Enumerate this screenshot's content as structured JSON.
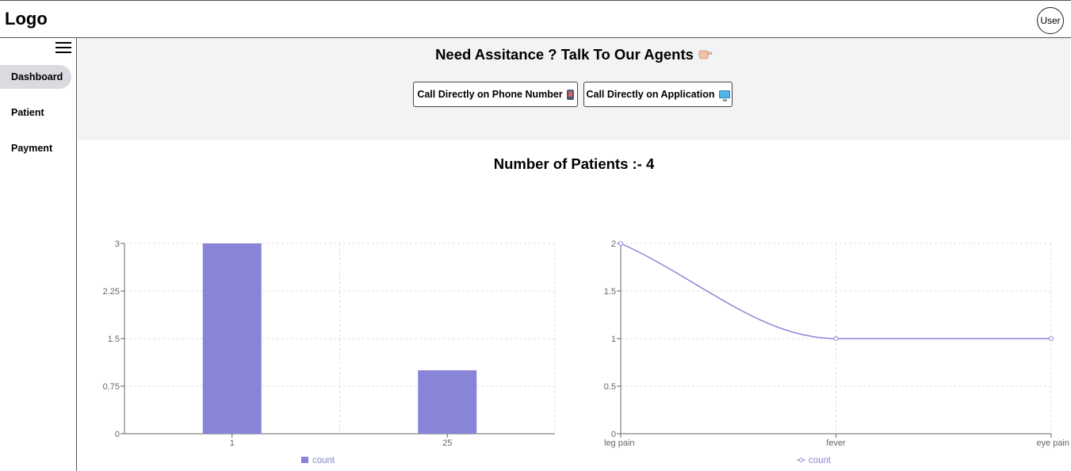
{
  "header": {
    "logo": "Logo",
    "user_label": "User"
  },
  "sidebar": {
    "items": [
      {
        "label": "Dashboard",
        "active": true
      },
      {
        "label": "Patient",
        "active": false
      },
      {
        "label": "Payment",
        "active": false
      }
    ]
  },
  "assist": {
    "title": "Need Assitance ? Talk To Our Agents",
    "buttons": [
      {
        "label": "Call Directly on Phone Number",
        "icon": "mobile-phone-icon"
      },
      {
        "label": "Call Directly on Application",
        "icon": "computer-monitor-icon"
      }
    ]
  },
  "patients": {
    "title": "Number of Patients :- 4"
  },
  "colors": {
    "series": "#8884d8",
    "grid": "#dddddd",
    "axis": "#666666",
    "panel_bg": "#f2f3f5"
  },
  "chart_data": [
    {
      "type": "bar",
      "categories": [
        "1",
        "25"
      ],
      "series": [
        {
          "name": "count",
          "values": [
            3,
            1
          ]
        }
      ],
      "yticks": [
        "0",
        "0.75",
        "1.5",
        "2.25",
        "3"
      ],
      "ylim": [
        0,
        3
      ],
      "grid": true,
      "legend": "bottom"
    },
    {
      "type": "line",
      "categories": [
        "leg pain",
        "fever",
        "eye pain"
      ],
      "series": [
        {
          "name": "count",
          "values": [
            2,
            1,
            1
          ]
        }
      ],
      "yticks": [
        "0",
        "0.5",
        "1",
        "1.5",
        "2"
      ],
      "ylim": [
        0,
        2
      ],
      "grid": true,
      "legend": "bottom"
    }
  ]
}
